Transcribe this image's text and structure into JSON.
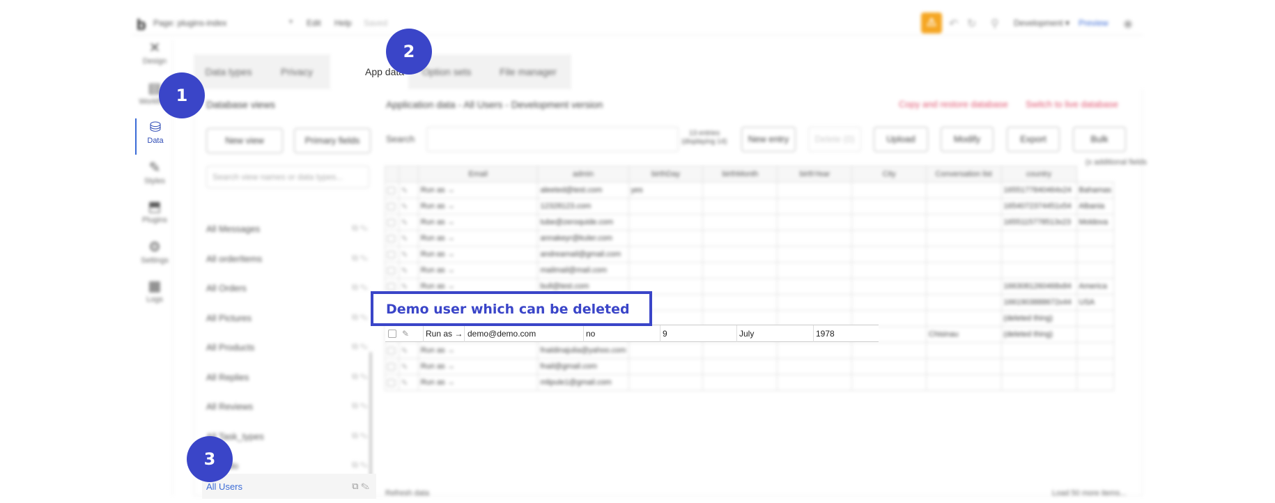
{
  "topbar": {
    "logo": "b",
    "page_select": "Page: plugins-index",
    "menu": [
      "Edit",
      "Help",
      "Saved"
    ],
    "environment": "Development",
    "preview": "Preview"
  },
  "nav": [
    {
      "label": "Design",
      "icon": "✕"
    },
    {
      "label": "Workflow",
      "icon": "▤"
    },
    {
      "label": "Data",
      "icon": "⛁"
    },
    {
      "label": "Styles",
      "icon": "✎"
    },
    {
      "label": "Plugins",
      "icon": "⬒"
    },
    {
      "label": "Settings",
      "icon": "⚙"
    },
    {
      "label": "Logs",
      "icon": "▦"
    }
  ],
  "tabs": [
    "Data types",
    "Privacy",
    "App data",
    "Option sets",
    "File manager"
  ],
  "database_views": {
    "title": "Database views",
    "new_view": "New view",
    "primary_fields": "Primary fields",
    "search_placeholder": "Search view names or data types...",
    "items": [
      "All Messages",
      "All orderItems",
      "All Orders",
      "All Pictures",
      "All Products",
      "All Replies",
      "All Reviews",
      "All Task_types",
      "All Todo",
      "All Users"
    ]
  },
  "main": {
    "title": "Application data - All Users - Development version",
    "copy_restore": "Copy and restore database",
    "switch_live": "Switch to live database",
    "search_label": "Search",
    "entries_line1": "13 entries",
    "entries_line2": "(displaying 14)",
    "buttons": {
      "new_entry": "New entry",
      "delete": "Delete (0)",
      "upload": "Upload",
      "modify": "Modify",
      "export": "Export",
      "bulk": "Bulk"
    },
    "additional_fields": "(x additional fields",
    "refresh": "Refresh data",
    "load_more": "Load 50 more items..."
  },
  "table": {
    "columns": [
      "",
      "",
      "Email",
      "admin",
      "birthDay",
      "birthMonth",
      "birthYear",
      "City",
      "Conversation list",
      "country"
    ],
    "rows": [
      [
        "Run as →",
        "aleeted@test.com",
        "yes",
        "",
        "",
        "",
        "",
        "1655177840464x24",
        "Bahamas"
      ],
      [
        "Run as →",
        "12328123.com",
        "",
        "",
        "",
        "",
        "",
        "1654072374451x54",
        "Albania"
      ],
      [
        "Run as →",
        "tube@zeroquide.com",
        "",
        "",
        "",
        "",
        "",
        "1655115778513x23",
        "Moldova"
      ],
      [
        "Run as →",
        "annakeyr@kuler.com",
        "",
        "",
        "",
        "",
        "",
        "",
        ""
      ],
      [
        "Run as →",
        "andreamail@gmail.com",
        "",
        "",
        "",
        "",
        "",
        "",
        ""
      ],
      [
        "Run as →",
        "mailmail@mail.com",
        "",
        "",
        "",
        "",
        "",
        "",
        ""
      ],
      [
        "Run as →",
        "bull@test.com",
        "",
        "",
        "",
        "",
        "",
        "1663081260468x84",
        "America"
      ],
      [
        "Run as →",
        "",
        "",
        "",
        "",
        "",
        "",
        "1661903888672x44",
        "USA"
      ],
      [
        "Run as →",
        "",
        "",
        "",
        "",
        "",
        "",
        "(deleted thing)",
        ""
      ],
      [
        "Run as →",
        "demo@demo.com",
        "no",
        "9",
        "July",
        "1978",
        "Chisinau",
        "(deleted thing)",
        ""
      ],
      [
        "Run as →",
        "fnaldinajulia@yahoo.com",
        "",
        "",
        "",
        "",
        "",
        "",
        ""
      ],
      [
        "Run as →",
        "fnail@gmail.com",
        "",
        "",
        "",
        "",
        "",
        "",
        ""
      ],
      [
        "Run as →",
        "mlipule1@gmail.com",
        "",
        "",
        "",
        "",
        "",
        "",
        ""
      ]
    ]
  },
  "demo_row": {
    "run_as": "Run as →",
    "email": "demo@demo.com",
    "admin": "no",
    "birth_day": "9",
    "birth_month": "July",
    "birth_year": "1978"
  },
  "callout": "Demo user which can be deleted",
  "badges": [
    "1",
    "2",
    "3"
  ],
  "colors": {
    "accent": "#3a45c8",
    "link_red": "#e05570",
    "upgrade": "#f5a623"
  }
}
